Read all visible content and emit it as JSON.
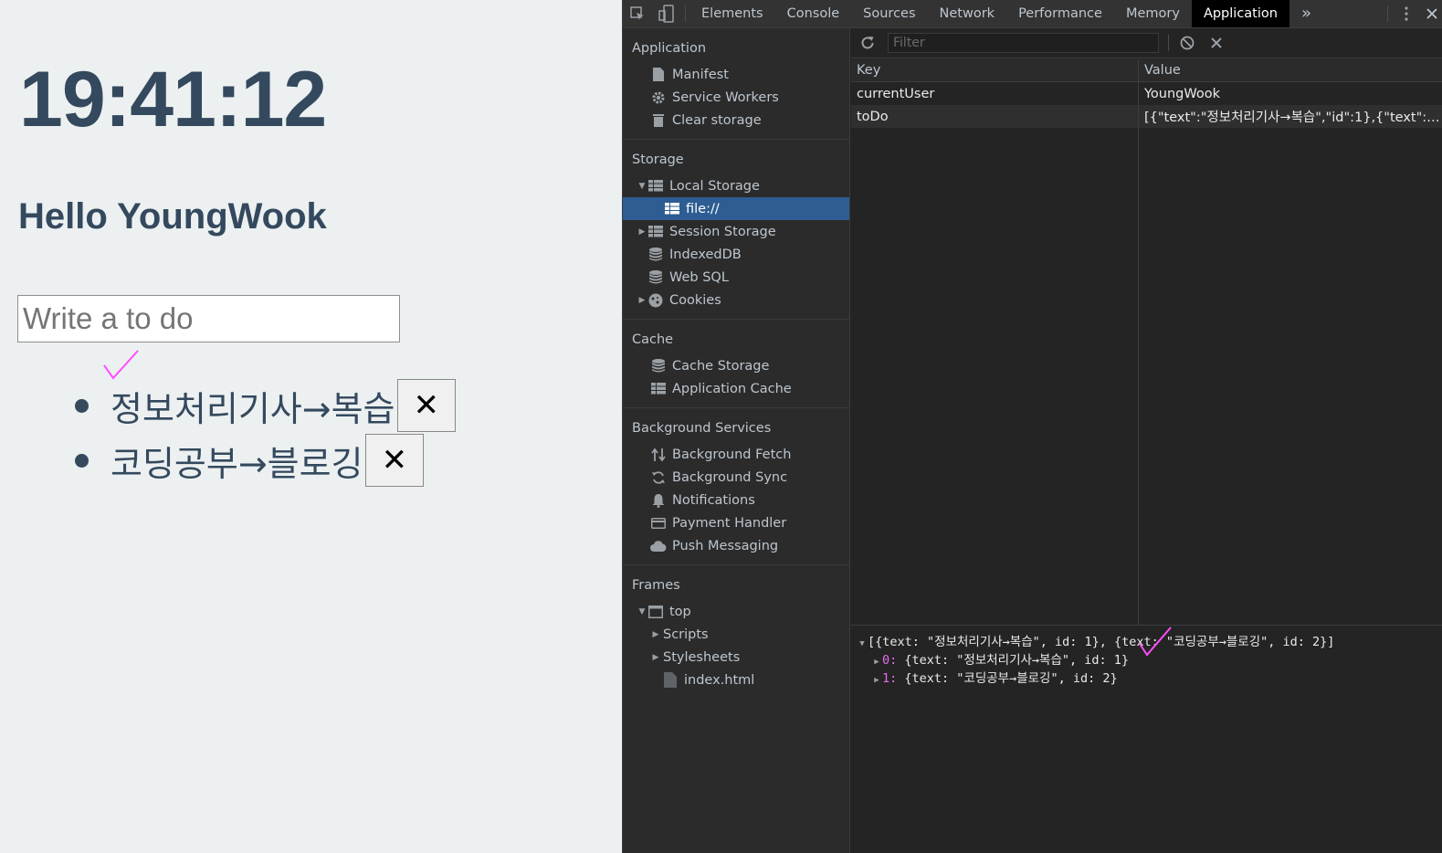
{
  "app": {
    "clock": "19:41:12",
    "greeting": "Hello YoungWook",
    "input_placeholder": "Write a to do",
    "todos": [
      {
        "text": "정보처리기사→복습",
        "delete_label": "✕"
      },
      {
        "text": "코딩공부→블로깅",
        "delete_label": "✕"
      }
    ]
  },
  "devtools": {
    "tabs": [
      "Elements",
      "Console",
      "Sources",
      "Network",
      "Performance",
      "Memory",
      "Application"
    ],
    "active_tab": "Application",
    "more_tabs_label": "»",
    "sidebar": {
      "application": {
        "header": "Application",
        "items": [
          "Manifest",
          "Service Workers",
          "Clear storage"
        ]
      },
      "storage": {
        "header": "Storage",
        "local_storage": "Local Storage",
        "local_storage_child": "file://",
        "session_storage": "Session Storage",
        "indexeddb": "IndexedDB",
        "websql": "Web SQL",
        "cookies": "Cookies"
      },
      "cache": {
        "header": "Cache",
        "items": [
          "Cache Storage",
          "Application Cache"
        ]
      },
      "background": {
        "header": "Background Services",
        "items": [
          "Background Fetch",
          "Background Sync",
          "Notifications",
          "Payment Handler",
          "Push Messaging"
        ]
      },
      "frames": {
        "header": "Frames",
        "top": "top",
        "scripts": "Scripts",
        "stylesheets": "Stylesheets",
        "file": "index.html"
      }
    },
    "filter_placeholder": "Filter",
    "table": {
      "col_key": "Key",
      "col_value": "Value",
      "rows": [
        {
          "key": "currentUser",
          "value": "YoungWook"
        },
        {
          "key": "toDo",
          "value": "[{\"text\":\"정보처리기사→복습\",\"id\":1},{\"text\":\"..."
        }
      ]
    },
    "preview": {
      "summary": "[{text: \"정보처리기사→복습\", id: 1}, {text: \"코딩공부→블로깅\", id: 2}]",
      "item0_index": "0:",
      "item0": " {text: \"정보처리기사→복습\", id: 1}",
      "item1_index": "1:",
      "item1": " {text: \"코딩공부→블로깅\", id: 2}"
    }
  },
  "colors": {
    "app_bg": "#ecf0f1",
    "app_text": "#34495e",
    "annotation": "#ff4dff",
    "selected_row": "#2d5d92"
  }
}
